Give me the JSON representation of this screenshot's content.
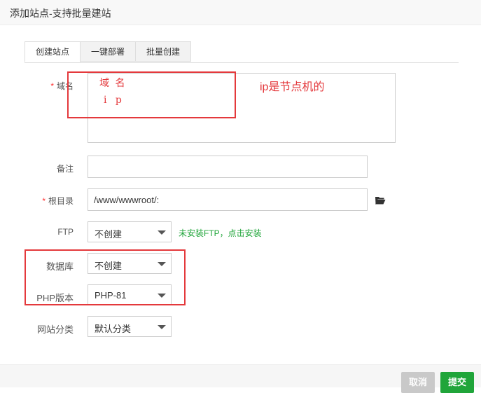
{
  "window": {
    "title": "添加站点-支持批量建站"
  },
  "tabs": [
    {
      "label": "创建站点",
      "active": true
    },
    {
      "label": "一键部署",
      "active": false
    },
    {
      "label": "批量创建",
      "active": false
    }
  ],
  "form": {
    "required_mark": "*",
    "domain": {
      "label": "域名",
      "handwritten_line1": "域 名",
      "handwritten_line2": "i p"
    },
    "remark": {
      "label": "备注",
      "value": ""
    },
    "root": {
      "label": "根目录",
      "value": "/www/wwwroot/:"
    },
    "ftp": {
      "label": "FTP",
      "selected": "不创建",
      "hint": "未安装FTP，点击安装"
    },
    "database": {
      "label": "数据库",
      "selected": "不创建"
    },
    "php": {
      "label": "PHP版本",
      "selected": "PHP-81"
    },
    "category": {
      "label": "网站分类",
      "selected": "默认分类"
    }
  },
  "annotation": {
    "text": "ip是节点机的"
  },
  "footer": {
    "cancel_label": "取消",
    "submit_label": "提交"
  },
  "colors": {
    "accent_green": "#20a53a",
    "annotation_red": "#e4393c",
    "cancel_gray": "#c9c9c9"
  }
}
